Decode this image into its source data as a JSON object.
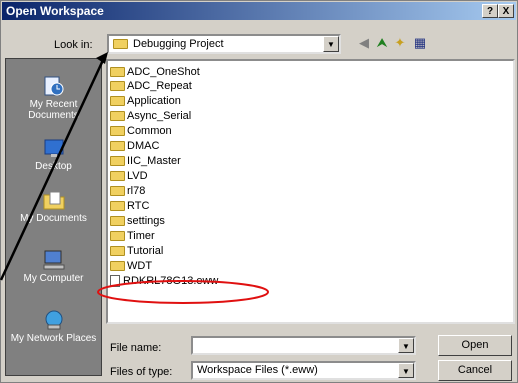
{
  "window": {
    "title": "Open Workspace",
    "help_label": "?",
    "close_label": "X"
  },
  "lookin": {
    "label": "Look in:",
    "value": "Debugging Project"
  },
  "toolbar": {
    "back_icon": "back-arrow-icon",
    "up_icon": "up-folder-icon",
    "newfolder_icon": "new-folder-icon",
    "views_icon": "views-menu-icon"
  },
  "places": [
    {
      "label": "My Recent Documents",
      "icon": "recent-documents-icon"
    },
    {
      "label": "Desktop",
      "icon": "desktop-icon"
    },
    {
      "label": "My Documents",
      "icon": "my-documents-icon"
    },
    {
      "label": "My Computer",
      "icon": "my-computer-icon"
    },
    {
      "label": "My Network Places",
      "icon": "network-places-icon"
    }
  ],
  "files": [
    {
      "name": "ADC_OneShot",
      "type": "folder"
    },
    {
      "name": "ADC_Repeat",
      "type": "folder"
    },
    {
      "name": "Application",
      "type": "folder"
    },
    {
      "name": "Async_Serial",
      "type": "folder"
    },
    {
      "name": "Common",
      "type": "folder"
    },
    {
      "name": "DMAC",
      "type": "folder"
    },
    {
      "name": "IIC_Master",
      "type": "folder"
    },
    {
      "name": "LVD",
      "type": "folder"
    },
    {
      "name": "rl78",
      "type": "folder"
    },
    {
      "name": "RTC",
      "type": "folder"
    },
    {
      "name": "settings",
      "type": "folder"
    },
    {
      "name": "Timer",
      "type": "folder"
    },
    {
      "name": "Tutorial",
      "type": "folder"
    },
    {
      "name": "WDT",
      "type": "folder"
    },
    {
      "name": "RDKRL78G13.eww",
      "type": "file"
    }
  ],
  "filename": {
    "label": "File name:",
    "value": ""
  },
  "filetype": {
    "label": "Files of type:",
    "value": "Workspace Files (*.eww)"
  },
  "buttons": {
    "open": "Open",
    "cancel": "Cancel"
  },
  "annotation": {
    "color": "#e01010"
  }
}
